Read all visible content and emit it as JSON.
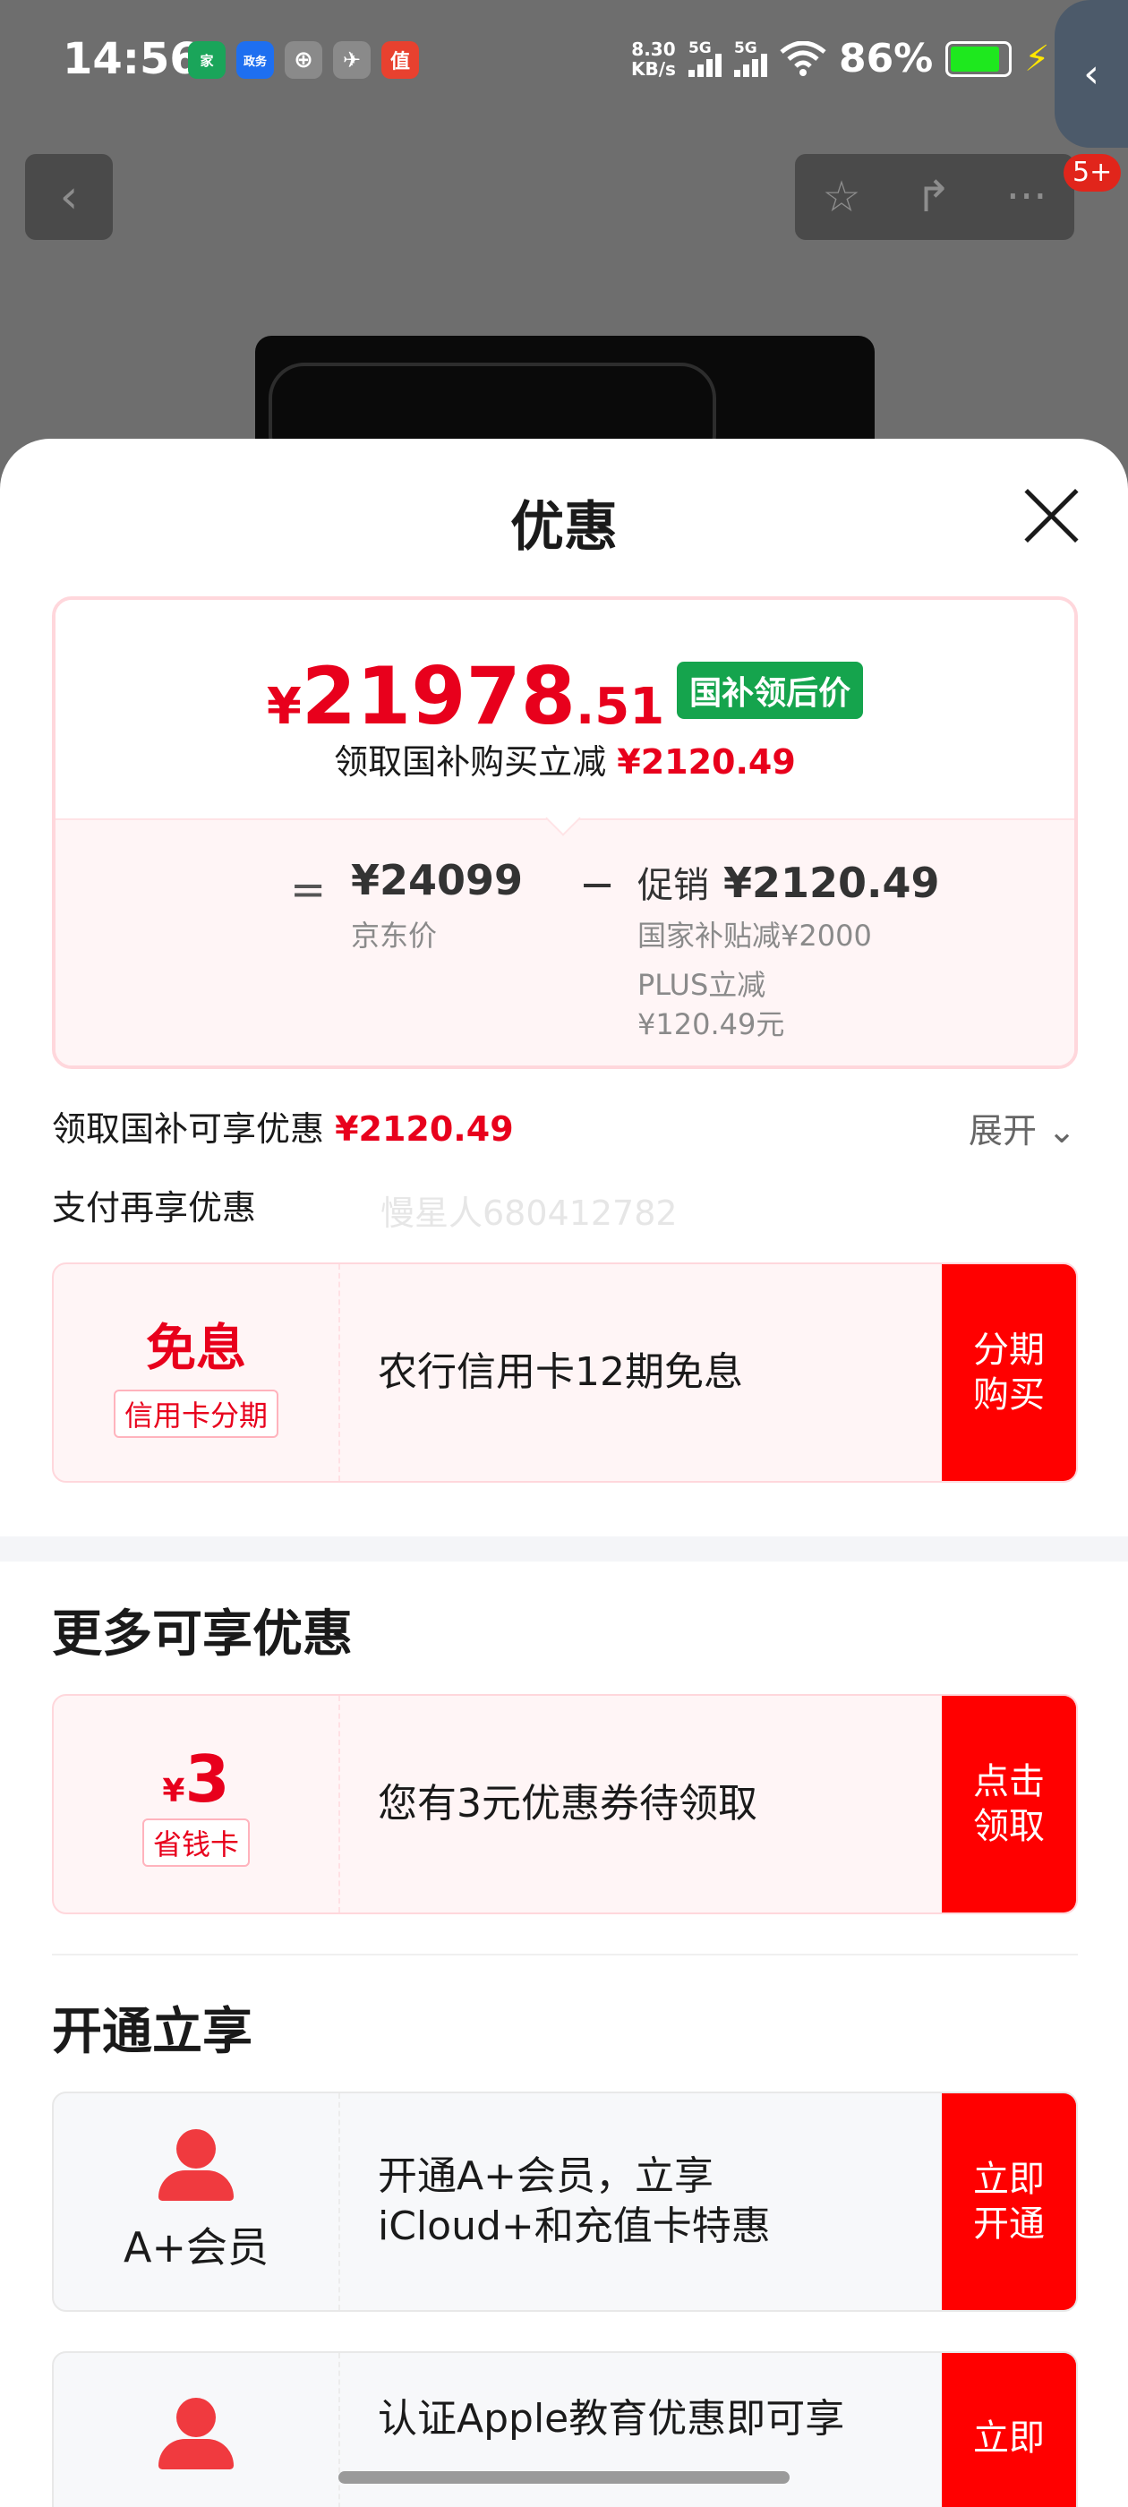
{
  "status_bar": {
    "time": "14:56",
    "app_icons": [
      {
        "name": "home-app-icon",
        "text": "家",
        "color": "#1aa55a"
      },
      {
        "name": "news-app-icon",
        "text": "政务",
        "color": "#1e6ff0"
      },
      {
        "name": "bank-app-icon",
        "text": "⊕",
        "color": "#8a8a8a"
      },
      {
        "name": "bird-app-icon",
        "text": "✈",
        "color": "#8a8a8a"
      },
      {
        "name": "value-app-icon",
        "text": "值",
        "color": "#e8412f"
      }
    ],
    "net_speed_value": "8.30",
    "net_speed_unit": "KB/s",
    "signal_1_label": "5G",
    "signal_2_label": "5G",
    "battery_percent": "86%",
    "battery_level": 0.86,
    "bolt": "⚡",
    "side_tab_icon": "‹"
  },
  "nav": {
    "back_icon": "‹",
    "favorite_icon": "☆",
    "share_icon": "↱",
    "more_icon": "···",
    "badge": "5+"
  },
  "sheet": {
    "title": "优惠",
    "price": {
      "currency": "¥",
      "integer": "21978",
      "decimal": ".51",
      "tag": "国补领后价",
      "sub_prefix": "领取国补购买立减",
      "sub_amount": "¥2120.49"
    },
    "breakdown": {
      "equals": "=",
      "jd_price": "¥24099",
      "jd_label": "京东价",
      "minus": "−",
      "promo_label": "促销",
      "promo_amount": "¥2120.49",
      "promo_line1": "国家补贴减¥2000",
      "promo_line2a": "PLUS立减",
      "promo_line2b": "¥120.49元"
    },
    "summary_prefix": "领取国补可享优惠",
    "summary_amount": "¥2120.49",
    "expand_label": "展开",
    "expand_icon": "⌄",
    "pay_label": "支付再享优惠",
    "watermark": "慢星人680412782",
    "pay_offer": {
      "big": "免息",
      "tag": "信用卡分期",
      "text": "农行信用卡12期免息",
      "button": "分期购买"
    },
    "more_title": "更多可享优惠",
    "coupon_offer": {
      "currency": "¥",
      "big": "3",
      "tag": "省钱卡",
      "text": "您有3元优惠券待领取",
      "button": "点击领取"
    },
    "open_title": "开通立享",
    "member_offer": {
      "label": "A+会员",
      "text_line1": "开通A+会员，立享",
      "text_line2": "iCloud+和充值卡特惠",
      "button": "立即开通"
    },
    "edu_offer": {
      "text": "认证Apple教育优惠即可享",
      "button": "立即"
    }
  },
  "colors": {
    "accent_red": "#e8001c",
    "button_red": "#ff0000",
    "tag_green": "#15a44d"
  }
}
